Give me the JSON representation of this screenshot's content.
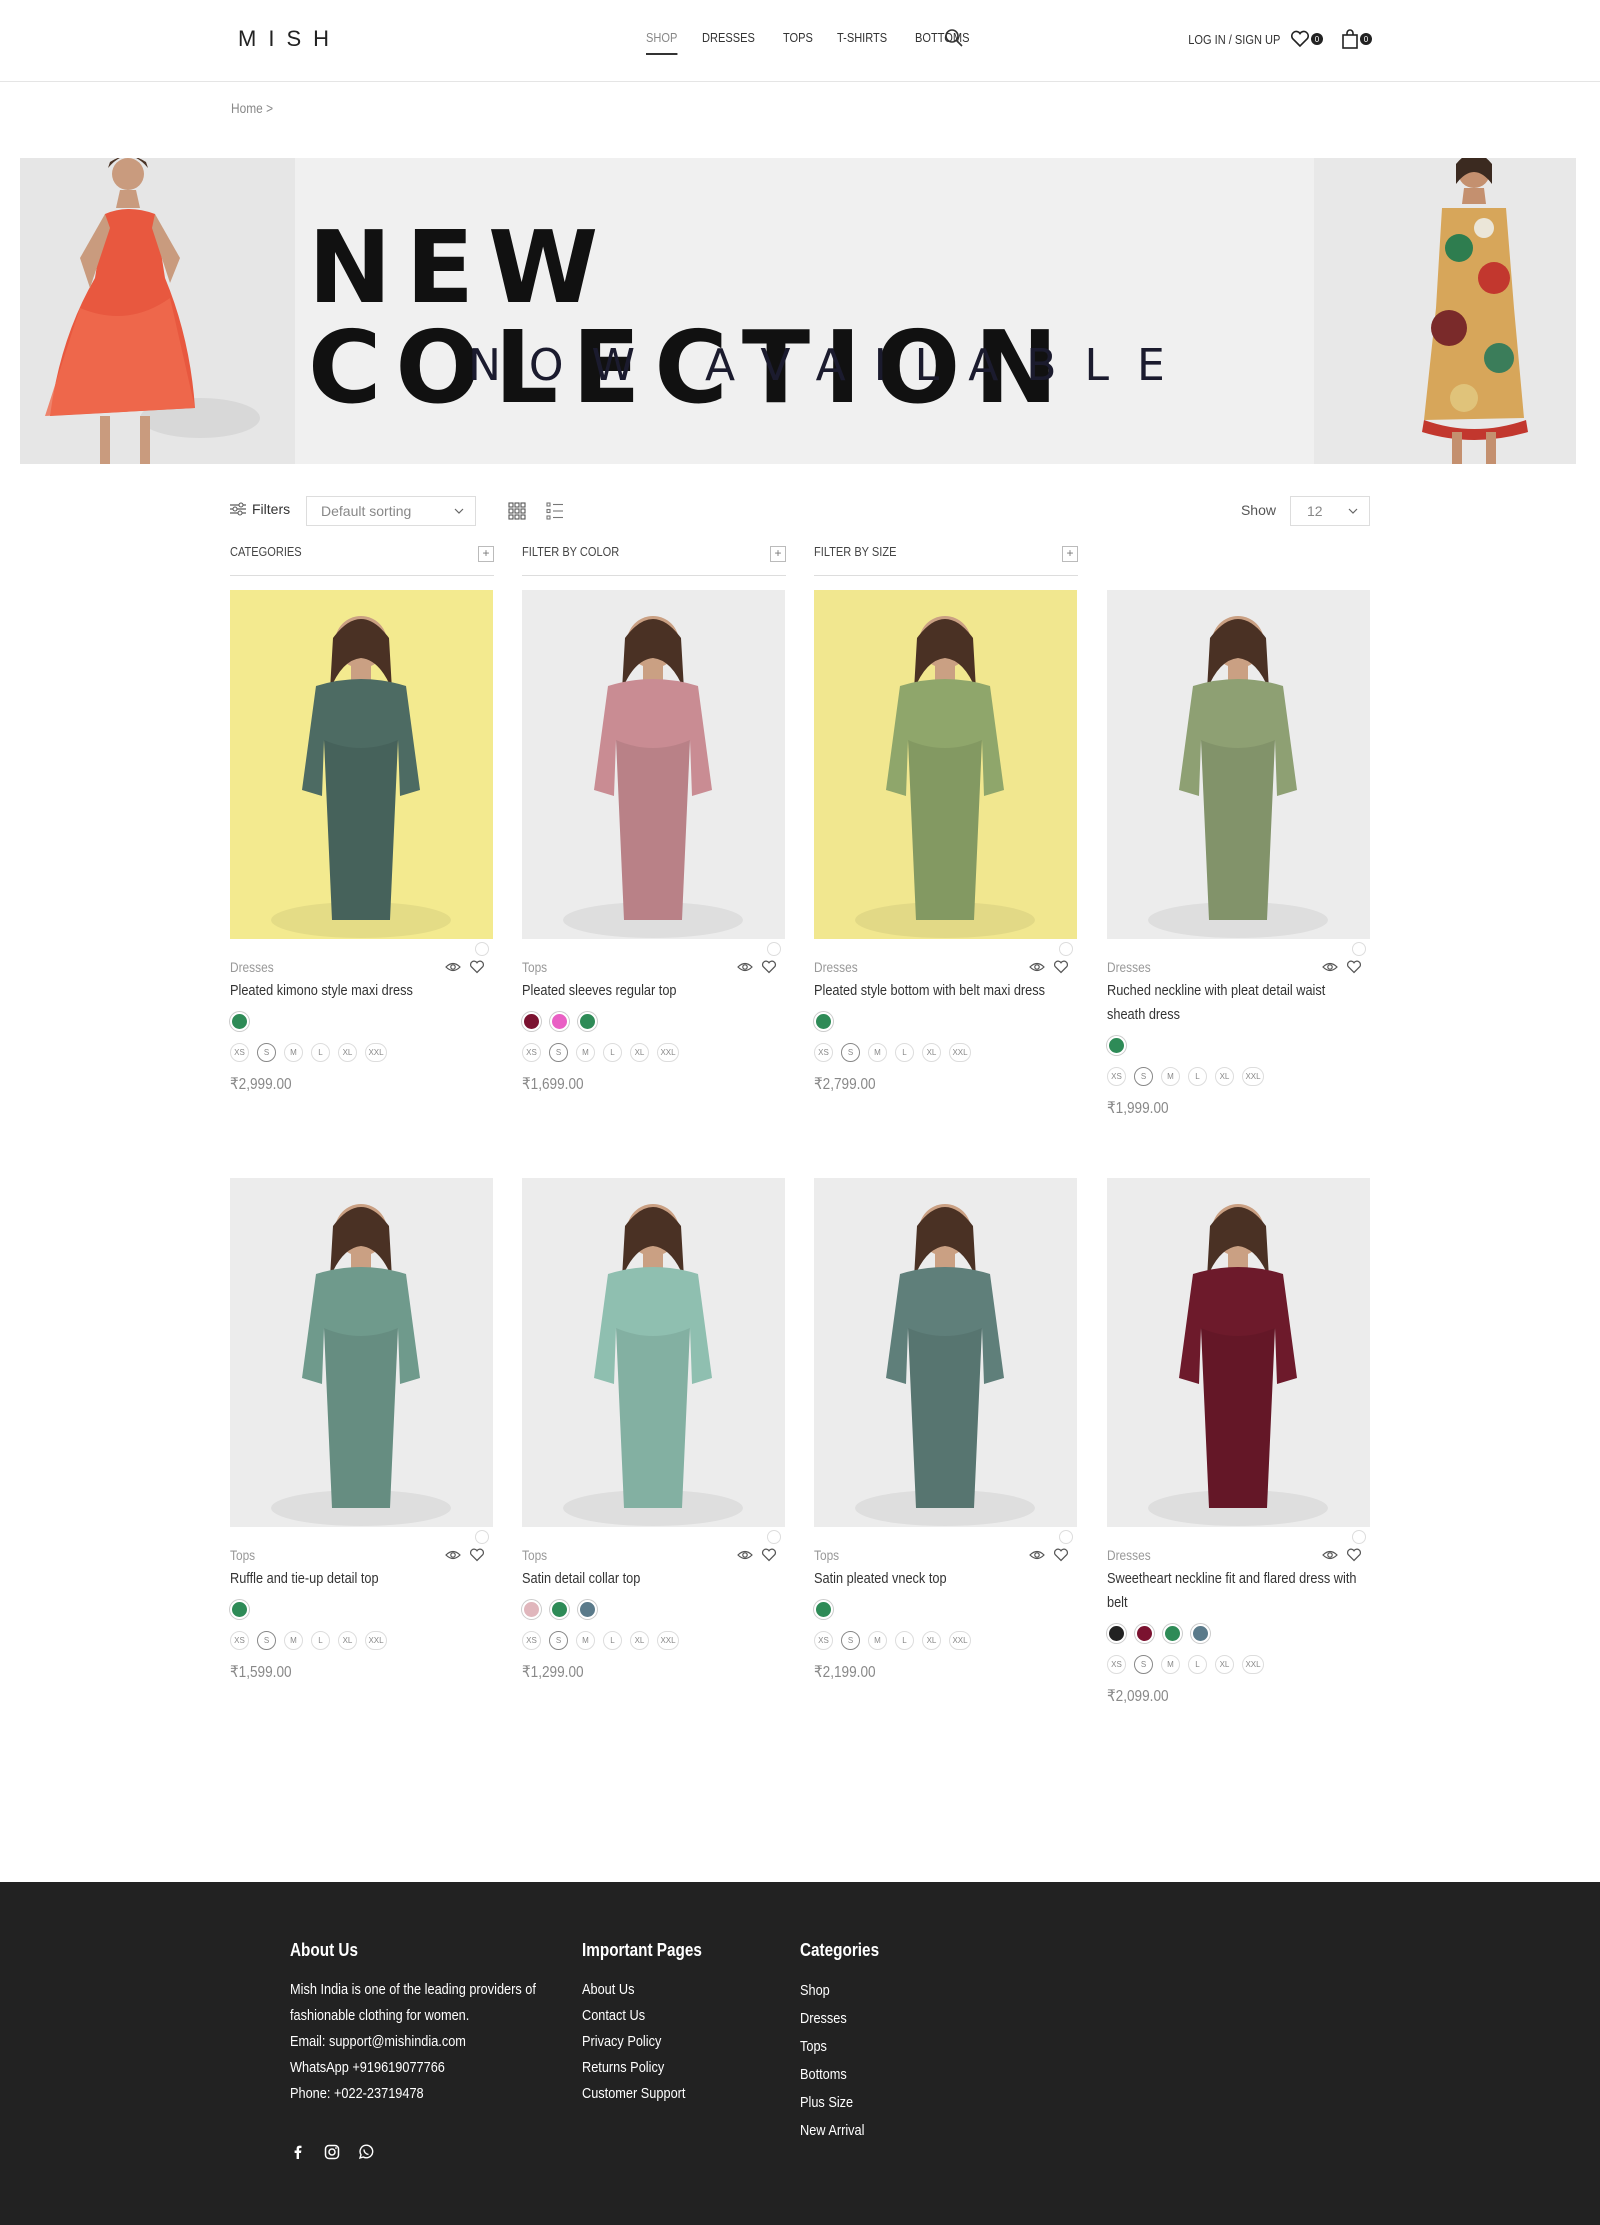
{
  "header": {
    "logo": "MISH",
    "nav": [
      "SHOP",
      "DRESSES",
      "TOPS",
      "T-SHIRTS",
      "BOTTOMS"
    ],
    "login": "LOG IN / SIGN UP",
    "wishlist_count": "0",
    "cart_count": "0"
  },
  "breadcrumb": "Home",
  "banner": {
    "title": "NEW COLECTION",
    "subtitle": "NOW AVAILABLE"
  },
  "toolbar": {
    "filters_label": "Filters",
    "sort_value": "Default sorting",
    "show_label": "Show",
    "show_value": "12"
  },
  "filters": {
    "categories": "CATEGORIES",
    "color": "FILTER BY COLOR",
    "size": "FILTER BY SIZE"
  },
  "sizes": [
    "XS",
    "S",
    "M",
    "L",
    "XL",
    "XXL"
  ],
  "products": [
    {
      "category": "Dresses",
      "title": "Pleated kimono style maxi dress",
      "price": "₹2,999.00",
      "swatches": [
        "#2e8b57"
      ],
      "bg": "#f3ea8f",
      "cloth": "#4d6b63"
    },
    {
      "category": "Tops",
      "title": "Pleated sleeves regular top",
      "price": "₹1,699.00",
      "swatches": [
        "#7b1230",
        "#e95fc4",
        "#2e8b57"
      ],
      "bg": "#ececec",
      "cloth": "#c98c93"
    },
    {
      "category": "Dresses",
      "title": "Pleated style bottom with belt maxi dress",
      "price": "₹2,799.00",
      "swatches": [
        "#2e8b57"
      ],
      "bg": "#f1e78f",
      "cloth": "#8fa66b"
    },
    {
      "category": "Dresses",
      "title": "Ruched neckline with pleat detail waist sheath dress",
      "price": "₹1,999.00",
      "swatches": [
        "#2e8b57"
      ],
      "bg": "#ececec",
      "cloth": "#8ea073"
    },
    {
      "category": "Tops",
      "title": "Ruffle and tie-up detail top",
      "price": "₹1,599.00",
      "swatches": [
        "#2e8b57"
      ],
      "bg": "#ececec",
      "cloth": "#6f9a8c"
    },
    {
      "category": "Tops",
      "title": "Satin detail collar top",
      "price": "₹1,299.00",
      "swatches": [
        "#e0b6bc",
        "#2e8b57",
        "#5a7a8a"
      ],
      "bg": "#ececec",
      "cloth": "#8fbfb0"
    },
    {
      "category": "Tops",
      "title": "Satin pleated vneck top",
      "price": "₹2,199.00",
      "swatches": [
        "#2e8b57"
      ],
      "bg": "#ececec",
      "cloth": "#5f7f7a"
    },
    {
      "category": "Dresses",
      "title": "Sweetheart neckline fit and flared dress with belt",
      "price": "₹2,099.00",
      "swatches": [
        "#222222",
        "#7b1230",
        "#2e8b57",
        "#5a7a8a"
      ],
      "bg": "#ececec",
      "cloth": "#6d1a2b"
    }
  ],
  "footer": {
    "about": {
      "heading": "About Us",
      "lines": [
        "Mish India is one of the leading providers of",
        "fashionable clothing for women.",
        "Email: support@mishindia.com",
        "WhatsApp +919619077766",
        "Phone: +022-23719478"
      ]
    },
    "pages": {
      "heading": "Important Pages",
      "links": [
        "About Us",
        "Contact Us",
        "Privacy Policy",
        "Returns Policy",
        "Customer Support"
      ]
    },
    "categories": {
      "heading": "Categories",
      "links": [
        "Shop",
        "Dresses",
        "Tops",
        "Bottoms",
        "Plus Size",
        "New Arrival"
      ]
    }
  }
}
